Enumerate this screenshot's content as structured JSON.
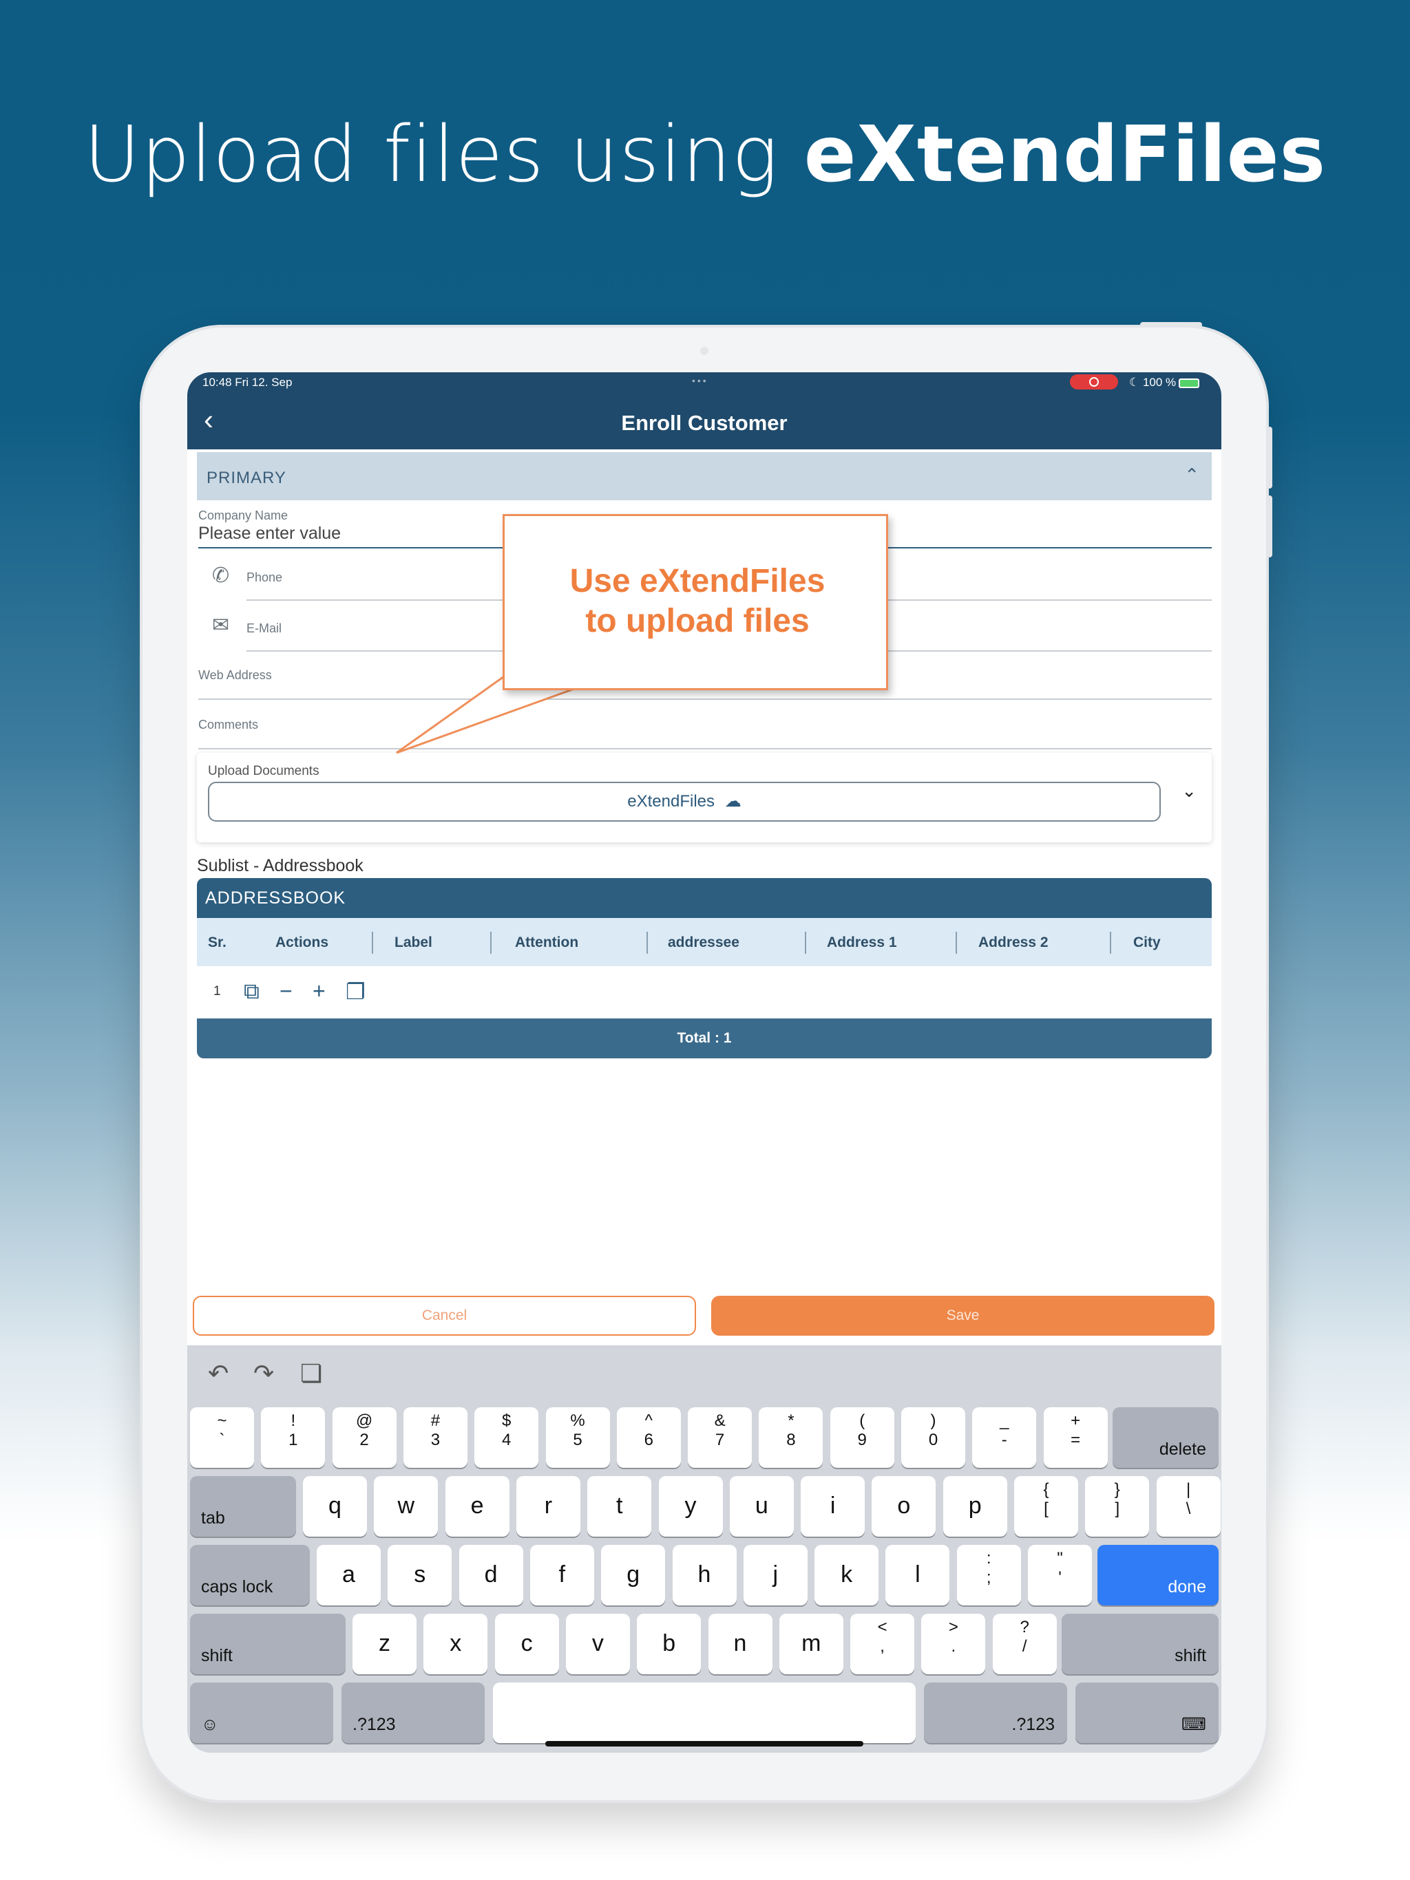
{
  "headline": {
    "light": "Upload files using ",
    "bold": "eXtendFiles"
  },
  "statusbar": {
    "time": "10:48  Fri 12. Sep",
    "dots": "•••",
    "battery": "100 %"
  },
  "navbar": {
    "back": "‹",
    "title": "Enroll Customer"
  },
  "section": {
    "label": "PRIMARY",
    "chevron": "⌃"
  },
  "fields": {
    "company_label": "Company Name",
    "company_placeholder": "Please enter value",
    "phone": "Phone",
    "email": "E-Mail",
    "web": "Web Address",
    "comments": "Comments"
  },
  "callout": {
    "line1": "Use eXtendFiles",
    "line2": "to upload files"
  },
  "upload": {
    "label": "Upload Documents",
    "button": "eXtendFiles",
    "dropdown": "⌄"
  },
  "sublist": {
    "label": "Sublist - Addressbook",
    "header": "ADDRESSBOOK",
    "columns": [
      "Sr.",
      "Actions",
      "Label",
      "Attention",
      "addressee",
      "Address 1",
      "Address 2",
      "City"
    ],
    "row_num": "1",
    "total": "Total : 1"
  },
  "buttons": {
    "cancel": "Cancel",
    "save": "Save"
  },
  "keyboard": {
    "row1": [
      {
        "top": "~",
        "bot": "`"
      },
      {
        "top": "!",
        "bot": "1"
      },
      {
        "top": "@",
        "bot": "2"
      },
      {
        "top": "#",
        "bot": "3"
      },
      {
        "top": "$",
        "bot": "4"
      },
      {
        "top": "%",
        "bot": "5"
      },
      {
        "top": "^",
        "bot": "6"
      },
      {
        "top": "&",
        "bot": "7"
      },
      {
        "top": "*",
        "bot": "8"
      },
      {
        "top": "(",
        "bot": "9"
      },
      {
        "top": ")",
        "bot": "0"
      },
      {
        "top": "_",
        "bot": "-"
      },
      {
        "top": "+",
        "bot": "="
      }
    ],
    "delete": "delete",
    "tab": "tab",
    "row2": [
      "q",
      "w",
      "e",
      "r",
      "t",
      "y",
      "u",
      "i",
      "o",
      "p"
    ],
    "row2_sym": [
      {
        "top": "{",
        "bot": "["
      },
      {
        "top": "}",
        "bot": "]"
      },
      {
        "top": "|",
        "bot": "\\"
      }
    ],
    "caps": "caps lock",
    "row3": [
      "a",
      "s",
      "d",
      "f",
      "g",
      "h",
      "j",
      "k",
      "l"
    ],
    "row3_sym": [
      {
        "top": ":",
        "bot": ";"
      },
      {
        "top": "\"",
        "bot": "'"
      }
    ],
    "done": "done",
    "shift": "shift",
    "row4": [
      "z",
      "x",
      "c",
      "v",
      "b",
      "n",
      "m"
    ],
    "row4_sym": [
      {
        "top": "<",
        "bot": ","
      },
      {
        "top": ">",
        "bot": "."
      },
      {
        "top": "?",
        "bot": "/"
      }
    ],
    "numkey": ".?123",
    "emoji": "☺",
    "kbhide": "⌨"
  },
  "colors": {
    "accent": "#ef8748",
    "nav": "#1f4a6b",
    "done": "#2f7cf6"
  }
}
